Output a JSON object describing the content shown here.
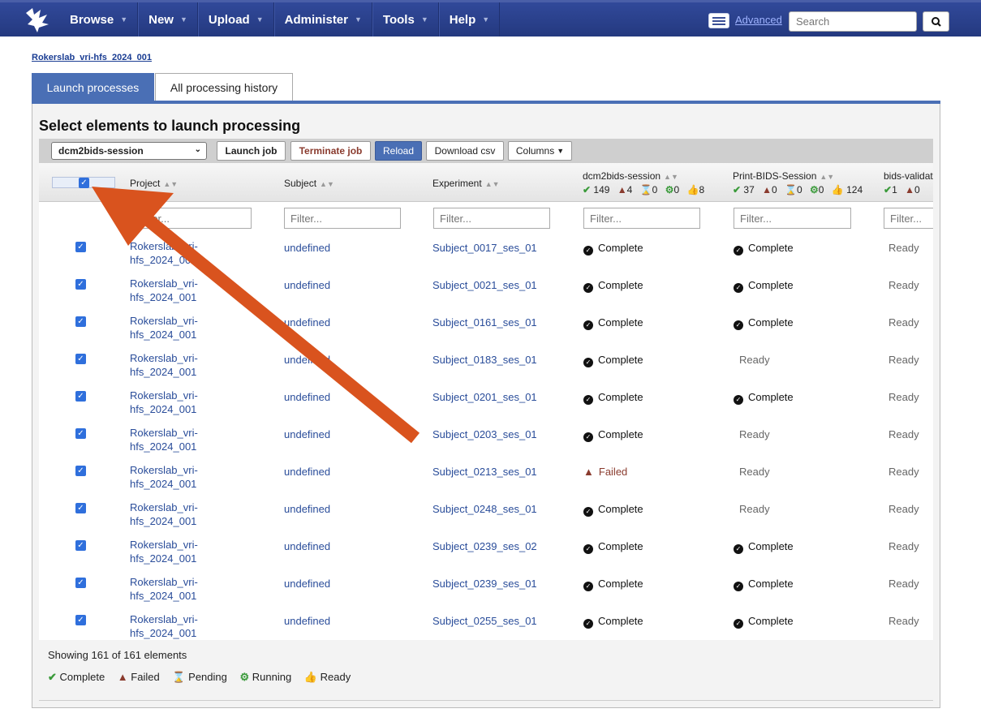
{
  "nav": {
    "items": [
      {
        "label": "Browse"
      },
      {
        "label": "New"
      },
      {
        "label": "Upload"
      },
      {
        "label": "Administer"
      },
      {
        "label": "Tools"
      },
      {
        "label": "Help"
      }
    ],
    "advanced_label": "Advanced",
    "search_placeholder": "Search"
  },
  "breadcrumb": "Rokerslab_vri-hfs_2024_001",
  "tabs": {
    "active": "Launch processes",
    "inactive": "All processing history"
  },
  "panel": {
    "title": "Select elements to launch processing",
    "selected_pipeline": "dcm2bids-session",
    "buttons": {
      "launch": "Launch job",
      "terminate": "Terminate job",
      "reload": "Reload",
      "download": "Download csv",
      "columns": "Columns"
    }
  },
  "table": {
    "headers": {
      "project": "Project",
      "subject": "Subject",
      "experiment": "Experiment",
      "col1": "dcm2bids-session",
      "col2": "Print-BIDS-Session",
      "col3": "bids-validat"
    },
    "col1_stats": {
      "complete": "149",
      "failed": "4",
      "pending": "0",
      "running": "0",
      "ready": "8"
    },
    "col2_stats": {
      "complete": "37",
      "failed": "0",
      "pending": "0",
      "running": "0",
      "ready": "124"
    },
    "col3_stats": {
      "complete": "1",
      "failed": "0"
    },
    "filter_placeholder": "Filter...",
    "rows": [
      {
        "project": "Rokerslab_vri-hfs_2024_001",
        "subject": "undefined",
        "experiment": "Subject_0017_ses_01",
        "s1": "Complete",
        "s2": "Complete",
        "s3": "Ready"
      },
      {
        "project": "Rokerslab_vri-hfs_2024_001",
        "subject": "undefined",
        "experiment": "Subject_0021_ses_01",
        "s1": "Complete",
        "s2": "Complete",
        "s3": "Ready"
      },
      {
        "project": "Rokerslab_vri-hfs_2024_001",
        "subject": "undefined",
        "experiment": "Subject_0161_ses_01",
        "s1": "Complete",
        "s2": "Complete",
        "s3": "Ready"
      },
      {
        "project": "Rokerslab_vri-hfs_2024_001",
        "subject": "undefined",
        "experiment": "Subject_0183_ses_01",
        "s1": "Complete",
        "s2": "Ready",
        "s3": "Ready"
      },
      {
        "project": "Rokerslab_vri-hfs_2024_001",
        "subject": "undefined",
        "experiment": "Subject_0201_ses_01",
        "s1": "Complete",
        "s2": "Complete",
        "s3": "Ready"
      },
      {
        "project": "Rokerslab_vri-hfs_2024_001",
        "subject": "undefined",
        "experiment": "Subject_0203_ses_01",
        "s1": "Complete",
        "s2": "Ready",
        "s3": "Ready"
      },
      {
        "project": "Rokerslab_vri-hfs_2024_001",
        "subject": "undefined",
        "experiment": "Subject_0213_ses_01",
        "s1": "Failed",
        "s2": "Ready",
        "s3": "Ready"
      },
      {
        "project": "Rokerslab_vri-hfs_2024_001",
        "subject": "undefined",
        "experiment": "Subject_0248_ses_01",
        "s1": "Complete",
        "s2": "Ready",
        "s3": "Ready"
      },
      {
        "project": "Rokerslab_vri-hfs_2024_001",
        "subject": "undefined",
        "experiment": "Subject_0239_ses_02",
        "s1": "Complete",
        "s2": "Complete",
        "s3": "Ready"
      },
      {
        "project": "Rokerslab_vri-hfs_2024_001",
        "subject": "undefined",
        "experiment": "Subject_0239_ses_01",
        "s1": "Complete",
        "s2": "Complete",
        "s3": "Ready"
      },
      {
        "project": "Rokerslab_vri-hfs_2024_001",
        "subject": "undefined",
        "experiment": "Subject_0255_ses_01",
        "s1": "Complete",
        "s2": "Complete",
        "s3": "Ready"
      }
    ]
  },
  "footer": {
    "showing": "Showing 161 of 161 elements",
    "legend": {
      "complete": "Complete",
      "failed": "Failed",
      "pending": "Pending",
      "running": "Running",
      "ready": "Ready"
    }
  },
  "colors": {
    "nav": "#24397f",
    "accent": "#4a6fb5",
    "link": "#2a4d9a",
    "failed": "#8a3b2e",
    "complete": "#3a9a3a",
    "arrow": "#d9531e"
  }
}
